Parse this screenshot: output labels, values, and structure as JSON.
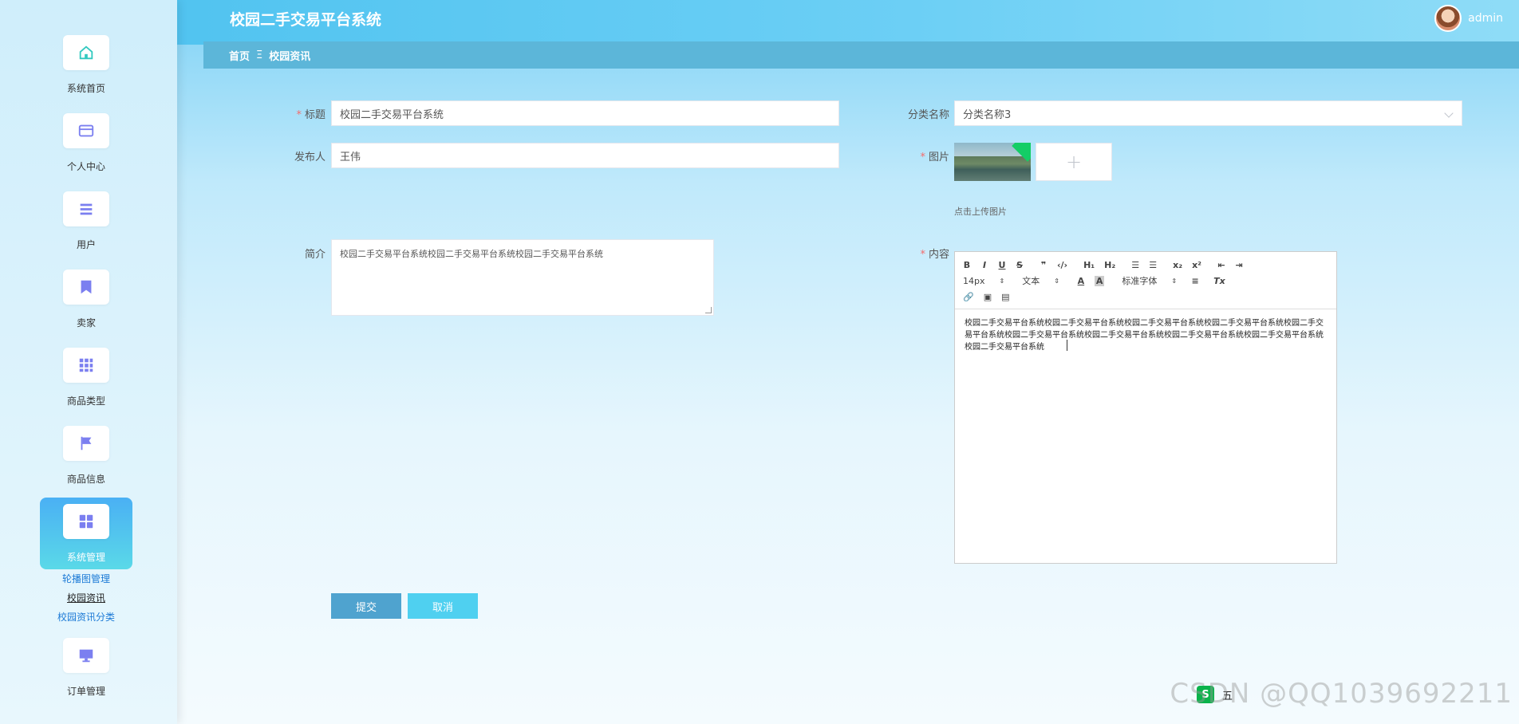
{
  "app": {
    "title": "校园二手交易平台系统",
    "user": "admin"
  },
  "breadcrumb": {
    "home": "首页",
    "separator": "Ξ",
    "current": "校园资讯"
  },
  "sidebar": {
    "items": [
      {
        "label": "系统首页",
        "icon": "home-icon"
      },
      {
        "label": "个人中心",
        "icon": "card-icon"
      },
      {
        "label": "用户",
        "icon": "list-icon"
      },
      {
        "label": "卖家",
        "icon": "bookmark-icon"
      },
      {
        "label": "商品类型",
        "icon": "grid-icon"
      },
      {
        "label": "商品信息",
        "icon": "flag-icon"
      },
      {
        "label": "系统管理",
        "icon": "apps-icon",
        "active": true
      },
      {
        "label": "订单管理",
        "icon": "monitor-icon"
      }
    ],
    "submenu": [
      {
        "label": "轮播图管理"
      },
      {
        "label": "校园资讯",
        "current": true
      },
      {
        "label": "校园资讯分类"
      }
    ]
  },
  "form": {
    "title": {
      "label": "标题",
      "required": "*",
      "value": "校园二手交易平台系统"
    },
    "category": {
      "label": "分类名称",
      "value": "分类名称3"
    },
    "publisher": {
      "label": "发布人",
      "value": "王伟"
    },
    "image": {
      "label": "图片",
      "required": "*",
      "upload_plus": "+",
      "hint": "点击上传图片"
    },
    "summary": {
      "label": "简介",
      "value": "校园二手交易平台系统校园二手交易平台系统校园二手交易平台系统"
    },
    "content": {
      "label": "内容",
      "required": "*",
      "toolbar": {
        "bold": "B",
        "italic": "I",
        "underline": "U",
        "strike": "S",
        "quote": "❞",
        "code": "‹/›",
        "h1": "H₁",
        "h2": "H₂",
        "ordered_list": "☰",
        "bullet_list": "☰",
        "subscript": "x₂",
        "superscript": "x²",
        "outdent": "⇤",
        "indent": "⇥",
        "size": "14px",
        "header": "文本",
        "color": "A",
        "background": "A",
        "font": "标准字体",
        "align": "≡",
        "clean": "Tx",
        "link": "🔗",
        "image": "▣",
        "video": "▤"
      },
      "value": "校园二手交易平台系统校园二手交易平台系统校园二手交易平台系统校园二手交易平台系统校园二手交易平台系统校园二手交易平台系统校园二手交易平台系统校园二手交易平台系统校园二手交易平台系统校园二手交易平台系统"
    }
  },
  "actions": {
    "submit": "提交",
    "cancel": "取消"
  },
  "ime": {
    "logo": "S",
    "mode": "五"
  },
  "watermark": "CSDN @QQ1039692211"
}
